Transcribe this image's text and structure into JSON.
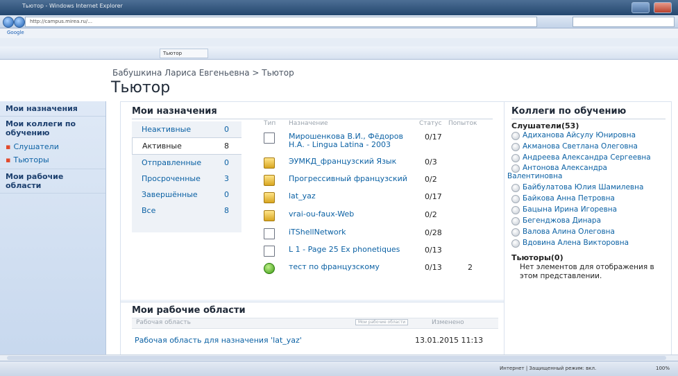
{
  "browser": {
    "window_title": "Tьютор - Windows Internet Explorer",
    "url": "http://campus.mirea.ru/…",
    "search_engine": "Google",
    "tab_label": "Tьютор",
    "status_text": "Интернет | Защищенный режим: вкл.",
    "zoom": "100%"
  },
  "page": {
    "breadcrumb": "Бабушкина Лариса Евгеньевна > Тьютор",
    "title": "Тьютор"
  },
  "left_nav": {
    "section1": "Мои назначения",
    "section2": "Мои коллеги по обучению",
    "sub1": "Слушатели",
    "sub2": "Тьюторы",
    "section3": "Мои рабочие области"
  },
  "assignments": {
    "title": "Мои назначения",
    "filters": [
      {
        "label": "Неактивные",
        "count": "0"
      },
      {
        "label": "Активные",
        "count": "8"
      },
      {
        "label": "Отправленные",
        "count": "0"
      },
      {
        "label": "Просроченные",
        "count": "3"
      },
      {
        "label": "Завершённые",
        "count": "0"
      },
      {
        "label": "Все",
        "count": "8"
      }
    ],
    "columns": {
      "type": "Тип",
      "name": "Назначение",
      "status": "Статус",
      "attempts": "Попыток"
    },
    "rows": [
      {
        "icon": "document-icon",
        "title": "Мирошенкова В.И., Фёдоров Н.А. - Lingua Latina - 2003",
        "status": "0/17",
        "attempts": ""
      },
      {
        "icon": "folder-icon",
        "title": "ЭУМКД_французский Язык",
        "status": "0/3",
        "attempts": ""
      },
      {
        "icon": "folder-icon",
        "title": "Прогрессивный французский",
        "status": "0/2",
        "attempts": ""
      },
      {
        "icon": "folder-icon",
        "title": "lat_yaz",
        "status": "0/17",
        "attempts": ""
      },
      {
        "icon": "folder-icon",
        "title": "vrai-ou-faux-Web",
        "status": "0/2",
        "attempts": ""
      },
      {
        "icon": "document-icon",
        "title": "iTShellNetwork",
        "status": "0/28",
        "attempts": ""
      },
      {
        "icon": "document-icon",
        "title": "L 1 - Page 25 Ex phonetiques",
        "status": "0/13",
        "attempts": ""
      },
      {
        "icon": "play-icon",
        "title": "тест по французскому",
        "status": "0/13",
        "attempts": "2"
      }
    ]
  },
  "workspaces": {
    "title": "Мои рабочие области",
    "col_workspace": "Рабочая область",
    "col_button": "Мои рабочие области",
    "col_changed": "Изменено",
    "row_name": "Рабочая область для назначения 'lat_yaz'",
    "row_date": "13.01.2015 11:13"
  },
  "colleagues": {
    "title": "Коллеги по обучению",
    "listeners_header": "Слушатели(53)",
    "listeners": [
      "Адиханова Айсулу Юнировна",
      "Акманова Светлана Олеговна",
      "Андреева Александра Сергеевна",
      "Антонова Александра",
      "Валентиновна",
      "Байбулатова Юлия Шамилевна",
      "Байкова Анна Петровна",
      "Бацына Ирина Игоревна",
      "Бегенджова Динара",
      "Валова Алина Олеговна",
      "Вдовина Алена Викторовна"
    ],
    "tutors_header": "Тьюторы(0)",
    "tutors_empty": "Нет элементов для отображения в этом представлении."
  }
}
